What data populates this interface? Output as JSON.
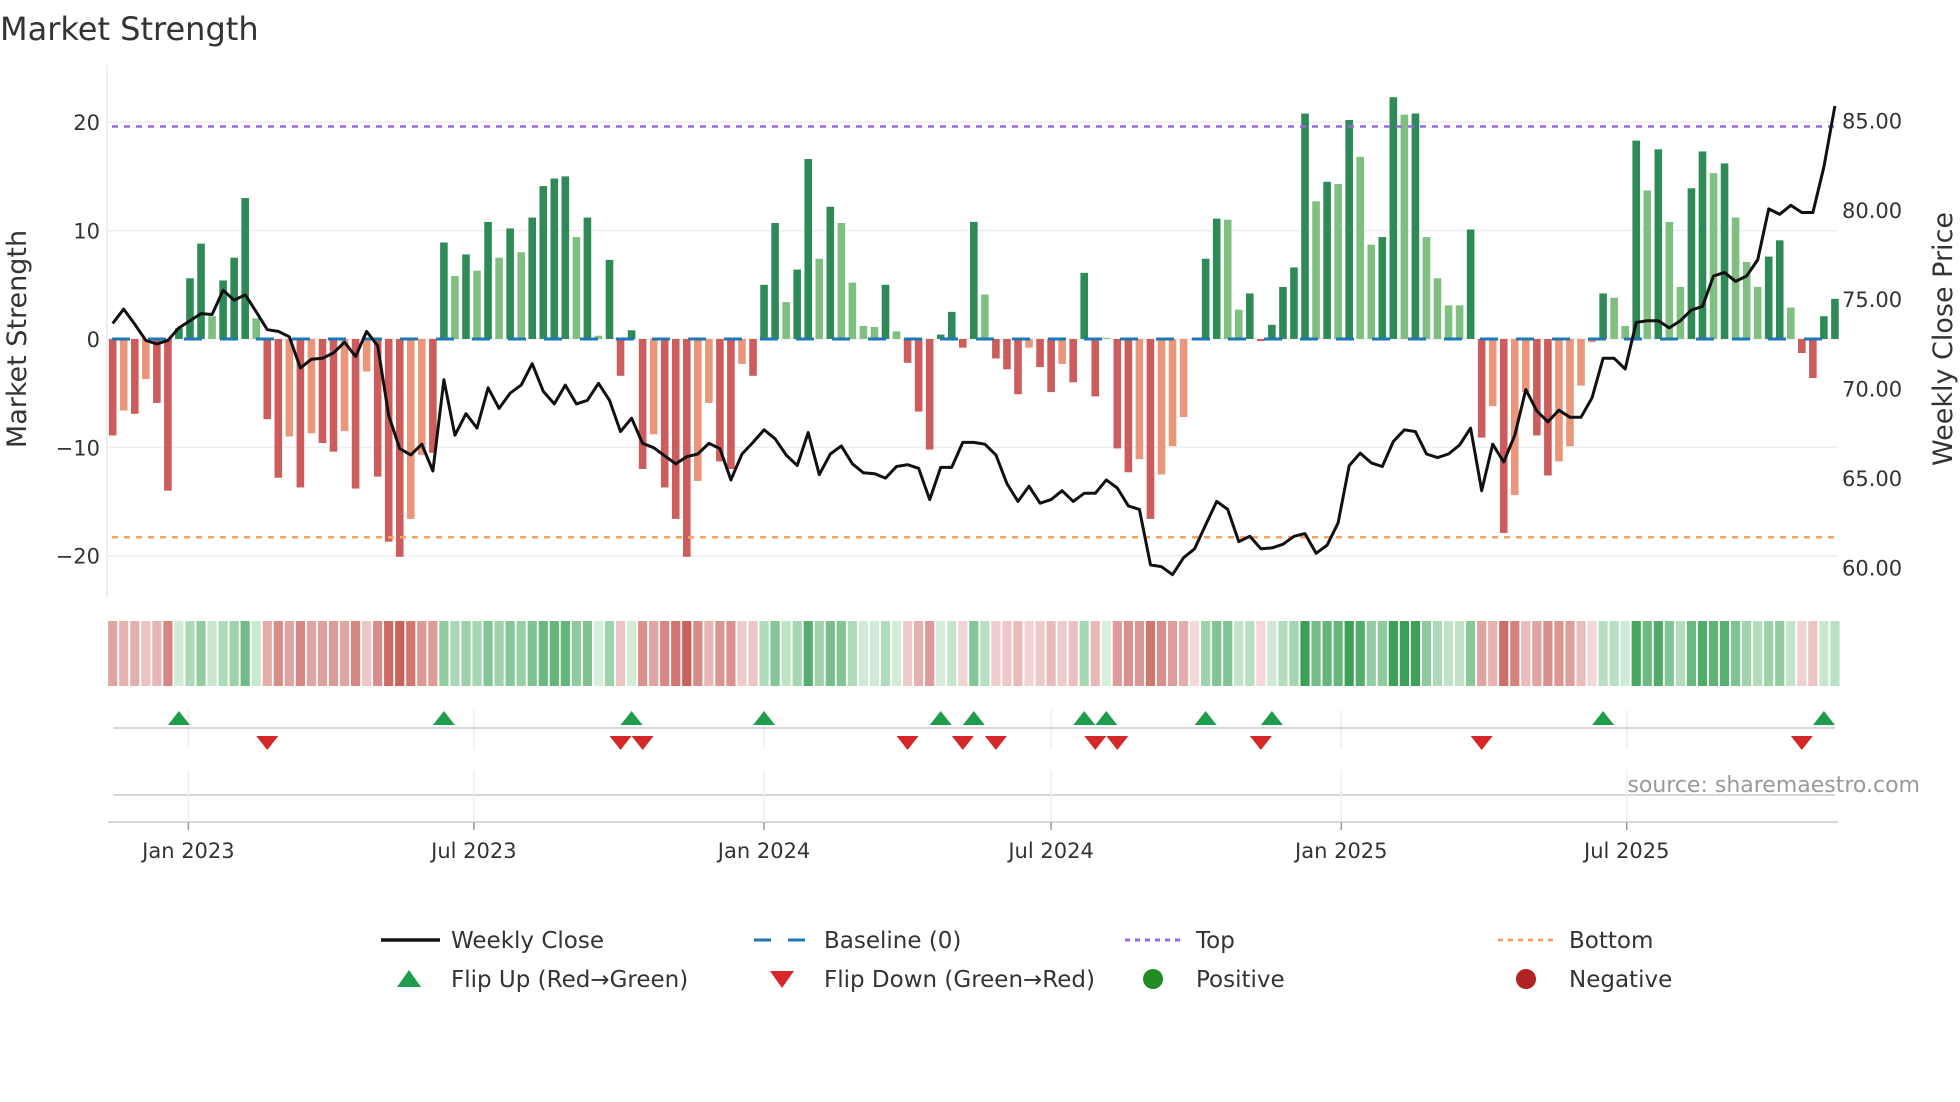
{
  "chart_data": {
    "type": "bar+line",
    "title": "Market Strength",
    "ylabel": "Market Strength",
    "y2label": "Weekly Close Price",
    "ylim": [
      -23.9,
      23.8
    ],
    "y2lim": [
      58.3,
      87.2
    ],
    "yticks": [
      20,
      10,
      0,
      -10,
      -20
    ],
    "ytick_labels": [
      "20",
      "10",
      "0",
      "−10",
      "−20"
    ],
    "y2ticks": [
      85,
      80,
      75,
      70,
      65,
      60
    ],
    "y2tick_labels": [
      "85.00",
      "80.00",
      "75.00",
      "70.00",
      "65.00",
      "60.00"
    ],
    "x_start": "2022-11-14",
    "x_step_days": 7,
    "xticks": [
      {
        "date": "2023-01-01",
        "label": "Jan 2023"
      },
      {
        "date": "2023-07-01",
        "label": "Jul 2023"
      },
      {
        "date": "2024-01-01",
        "label": "Jan 2024"
      },
      {
        "date": "2024-07-01",
        "label": "Jul 2024"
      },
      {
        "date": "2025-01-01",
        "label": "Jan 2025"
      },
      {
        "date": "2025-07-01",
        "label": "Jul 2025"
      }
    ],
    "top_level": 19.6,
    "bottom_level": -18.3,
    "baseline": 0,
    "grid": true,
    "strength": [
      -8.9,
      -6.6,
      -6.9,
      -3.7,
      -5.9,
      -14.0,
      1.0,
      5.6,
      8.8,
      2.1,
      5.4,
      7.5,
      13.0,
      1.9,
      -7.4,
      -12.8,
      -9.0,
      -13.7,
      -8.7,
      -9.6,
      -10.4,
      -8.5,
      -13.8,
      -3.0,
      -12.7,
      -18.7,
      -20.1,
      -16.6,
      -10.7,
      -10.5,
      8.9,
      5.8,
      7.8,
      6.3,
      10.8,
      7.5,
      10.2,
      8.0,
      11.2,
      14.1,
      14.8,
      15.0,
      9.4,
      11.2,
      0.3,
      7.3,
      -3.4,
      0.8,
      -12.0,
      -8.8,
      -13.7,
      -16.6,
      -20.1,
      -13.1,
      -5.9,
      -11.3,
      -12.0,
      -2.3,
      -3.4,
      5.0,
      10.7,
      3.4,
      6.4,
      16.6,
      7.4,
      12.2,
      10.7,
      5.2,
      1.2,
      1.1,
      5.0,
      0.7,
      -2.2,
      -6.7,
      -10.2,
      0.4,
      2.5,
      -0.8,
      10.8,
      4.1,
      -1.8,
      -2.8,
      -5.1,
      -0.8,
      -2.6,
      -4.9,
      -2.3,
      -4.0,
      6.1,
      -5.3,
      0.1,
      -10.1,
      -12.3,
      -11.1,
      -16.6,
      -12.5,
      -9.9,
      -7.2,
      -0.1,
      7.4,
      11.1,
      11.0,
      2.7,
      4.2,
      -0.2,
      1.3,
      4.8,
      6.6,
      20.8,
      12.7,
      14.5,
      14.3,
      20.2,
      16.8,
      8.7,
      9.4,
      22.3,
      20.7,
      20.8,
      9.4,
      5.6,
      3.1,
      3.1,
      10.1,
      -9.1,
      -6.2,
      -17.9,
      -14.4,
      -4.9,
      -8.9,
      -12.6,
      -11.3,
      -9.9,
      -4.3,
      -0.3,
      4.2,
      3.8,
      1.2,
      18.3,
      13.7,
      17.5,
      10.8,
      4.8,
      13.9,
      17.3,
      15.3,
      16.2,
      11.2,
      7.1,
      4.8,
      7.6,
      9.1,
      2.9,
      -1.3,
      -3.6,
      2.1,
      3.7
    ],
    "strength_shade": "DLDLDDDDDLDDDLDDLDLDDLDLDDDLLDDLDLDLDLDDDDLDLDDDDLDDDLLDDLDDDLDDLDLLLLDLDDDDDDDLDDDLDDLDDDLDDLDLLLLDDLLDDDDDDLDLDLLDDLDLLLLDDLDLLDDLLLLDLLDLDLLDDLDLLLDDLDDDD",
    "weekly_close": [
      73.65,
      74.45,
      73.6,
      72.7,
      72.5,
      72.7,
      73.4,
      73.8,
      74.2,
      74.15,
      75.5,
      74.95,
      75.25,
      74.3,
      73.3,
      73.2,
      72.9,
      71.15,
      71.65,
      71.7,
      72.0,
      72.6,
      71.8,
      73.2,
      72.4,
      68.5,
      66.65,
      66.3,
      66.9,
      65.4,
      70.5,
      67.4,
      68.6,
      67.8,
      70.05,
      68.9,
      69.75,
      70.2,
      71.4,
      69.85,
      69.15,
      70.2,
      69.15,
      69.35,
      70.3,
      69.35,
      67.6,
      68.35,
      66.95,
      66.7,
      66.25,
      65.8,
      66.2,
      66.35,
      66.95,
      66.65,
      64.9,
      66.35,
      67.0,
      67.7,
      67.2,
      66.3,
      65.7,
      67.55,
      65.2,
      66.35,
      66.8,
      65.8,
      65.3,
      65.25,
      65.0,
      65.65,
      65.75,
      65.55,
      63.8,
      65.6,
      65.6,
      67.0,
      67.0,
      66.9,
      66.3,
      64.7,
      63.7,
      64.55,
      63.6,
      63.8,
      64.3,
      63.7,
      64.15,
      64.15,
      64.9,
      64.45,
      63.45,
      63.25,
      60.15,
      60.05,
      59.6,
      60.55,
      61.05,
      62.4,
      63.7,
      63.25,
      61.45,
      61.75,
      61.05,
      61.1,
      61.3,
      61.75,
      61.9,
      60.8,
      61.25,
      62.5,
      65.7,
      66.4,
      65.85,
      65.65,
      67.05,
      67.7,
      67.6,
      66.35,
      66.15,
      66.35,
      66.85,
      67.8,
      64.3,
      66.9,
      65.9,
      67.4,
      69.95,
      68.75,
      68.15,
      68.8,
      68.4,
      68.4,
      69.5,
      71.7,
      71.7,
      71.1,
      73.7,
      73.8,
      73.8,
      73.4,
      73.8,
      74.4,
      74.6,
      76.3,
      76.5,
      76.0,
      76.3,
      77.2,
      80.05,
      79.75,
      80.25,
      79.85,
      79.85,
      82.4,
      85.8
    ],
    "legend": {
      "placement": "bottom",
      "entries": [
        {
          "label": "Weekly Close",
          "symbol": "line",
          "color": "#111111"
        },
        {
          "label": "Baseline (0)",
          "symbol": "dash",
          "color": "#1f77b4"
        },
        {
          "label": "Top",
          "symbol": "dot",
          "color": "#9a6ae0"
        },
        {
          "label": "Bottom",
          "symbol": "dot",
          "color": "#f4a460"
        },
        {
          "label": "Flip Up (Red→Green)",
          "symbol": "triangle-up",
          "color": "#1e9e4a"
        },
        {
          "label": "Flip Down (Green→Red)",
          "symbol": "triangle-down",
          "color": "#d62728"
        },
        {
          "label": "Positive",
          "symbol": "circle",
          "color": "#228b22"
        },
        {
          "label": "Negative",
          "symbol": "circle",
          "color": "#b22222"
        }
      ]
    },
    "source": "source: sharemaestro.com"
  },
  "colors": {
    "pos_dark": "#2e8b57",
    "pos_light": "#7fbf7f",
    "neg_dark": "#cd5c5c",
    "neg_light": "#e9967a",
    "flip_up": "#1e9e4a",
    "flip_down": "#d62728",
    "top": "#9a6ae0",
    "bottom": "#f4a460",
    "baseline": "#1f77b4"
  }
}
